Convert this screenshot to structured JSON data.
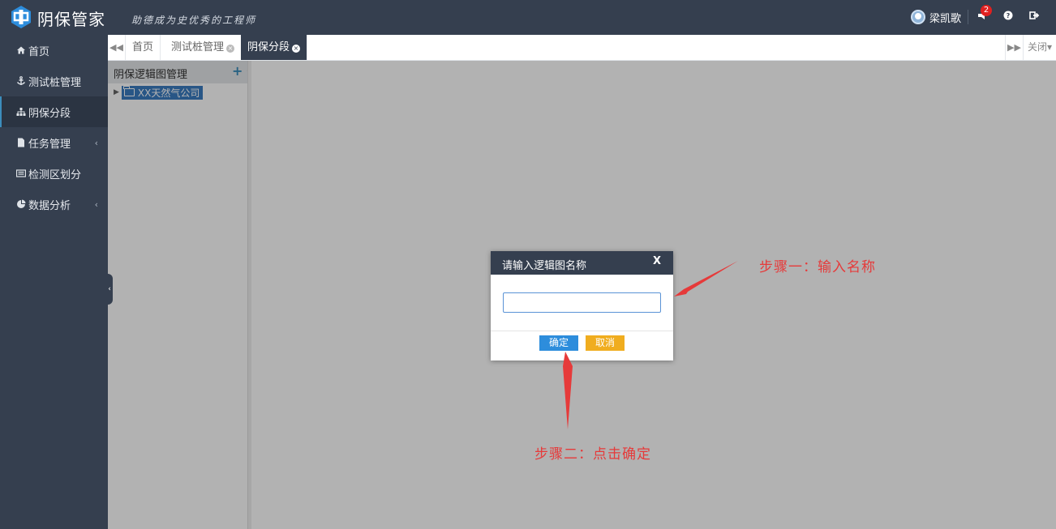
{
  "header": {
    "brand": "阴保管家",
    "slogan": "助德成为史优秀的工程师",
    "username": "梁凯歌",
    "notification_count": "2",
    "icons": [
      "logo-icon",
      "user-avatar",
      "bell-icon",
      "help-icon",
      "logout-icon"
    ]
  },
  "sidebar": {
    "items": [
      {
        "label": "首页",
        "icon": "home-icon",
        "active": false,
        "has_submenu": false
      },
      {
        "label": "测试桩管理",
        "icon": "anchor-icon",
        "active": false,
        "has_submenu": false
      },
      {
        "label": "阴保分段",
        "icon": "sitemap-icon",
        "active": true,
        "has_submenu": false
      },
      {
        "label": "任务管理",
        "icon": "file-icon",
        "active": false,
        "has_submenu": true
      },
      {
        "label": "检测区划分",
        "icon": "list-icon",
        "active": false,
        "has_submenu": false
      },
      {
        "label": "数据分析",
        "icon": "pie-chart-icon",
        "active": false,
        "has_submenu": true
      }
    ]
  },
  "tabs": {
    "items": [
      {
        "label": "首页",
        "closable": false,
        "active": false
      },
      {
        "label": "测试桩管理",
        "closable": true,
        "active": false
      },
      {
        "label": "阴保分段",
        "closable": true,
        "active": true
      }
    ],
    "close_menu": "关闭"
  },
  "tree": {
    "title": "阴保逻辑图管理",
    "nodes": [
      {
        "label": "XX天然气公司",
        "selected": true
      }
    ]
  },
  "dialog": {
    "title": "请输入逻辑图名称",
    "close": "X",
    "input_value": "",
    "ok_label": "确定",
    "cancel_label": "取消"
  },
  "annotations": {
    "step1": "步骤一：输入名称",
    "step2": "步骤二：点击确定"
  },
  "colors": {
    "header_bg": "#353f4f",
    "accent": "#2d8ddc",
    "cancel": "#f0ad1f",
    "annotation": "#e63a3a",
    "badge": "#e02020"
  }
}
